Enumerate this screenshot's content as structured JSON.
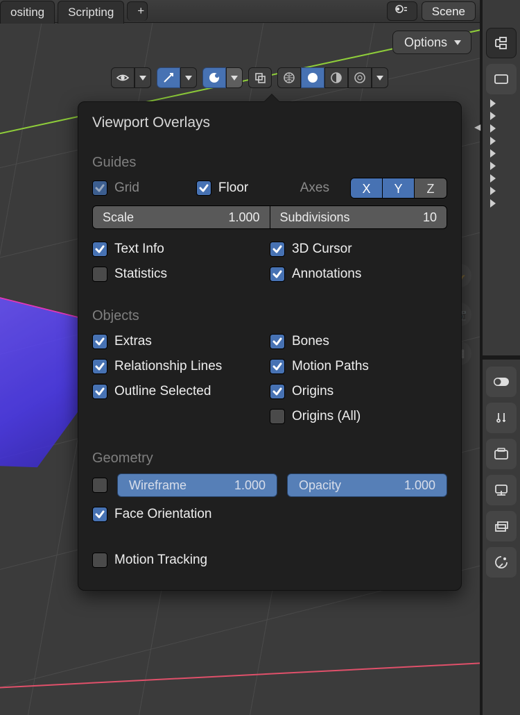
{
  "tabs": {
    "t0": "ositing",
    "t1": "Scripting",
    "plus": "+"
  },
  "scene": {
    "picker": "⬤▾",
    "name": "Scene"
  },
  "options": {
    "label": "Options"
  },
  "popover": {
    "title": "Viewport Overlays",
    "guides": {
      "label": "Guides",
      "grid": "Grid",
      "floor": "Floor",
      "axes_label": "Axes",
      "axis_x": "X",
      "axis_y": "Y",
      "axis_z": "Z",
      "scale_label": "Scale",
      "scale_value": "1.000",
      "subdiv_label": "Subdivisions",
      "subdiv_value": "10",
      "text_info": "Text Info",
      "statistics": "Statistics",
      "cursor3d": "3D Cursor",
      "annotations": "Annotations"
    },
    "objects": {
      "label": "Objects",
      "extras": "Extras",
      "relationship": "Relationship Lines",
      "outline_sel": "Outline Selected",
      "bones": "Bones",
      "motion_paths": "Motion Paths",
      "origins": "Origins",
      "origins_all": "Origins (All)"
    },
    "geometry": {
      "label": "Geometry",
      "wireframe_label": "Wireframe",
      "wireframe_value": "1.000",
      "opacity_label": "Opacity",
      "opacity_value": "1.000",
      "face_orientation": "Face Orientation"
    },
    "motion_tracking": "Motion Tracking"
  }
}
